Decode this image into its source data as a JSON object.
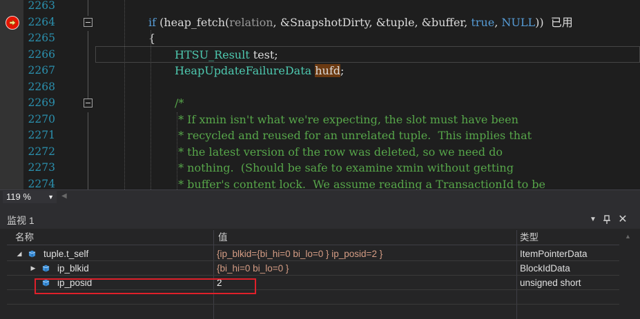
{
  "editor": {
    "line_numbers": [
      "2263",
      "2264",
      "2265",
      "2266",
      "2267",
      "2268",
      "2269",
      "2270",
      "2271",
      "2272",
      "2273",
      "2274"
    ],
    "lines": [
      {
        "segments": []
      },
      {
        "segments": [
          {
            "t": "if",
            "c": "kw"
          },
          {
            "t": " (heap_fetch(",
            "c": "fn"
          },
          {
            "t": "relation",
            "c": "param"
          },
          {
            "t": ", &SnapshotDirty, &tuple, &buffer, ",
            "c": "fn"
          },
          {
            "t": "true",
            "c": "kw"
          },
          {
            "t": ", ",
            "c": "fn"
          },
          {
            "t": "NULL",
            "c": "kw"
          },
          {
            "t": "))  已用",
            "c": "fn"
          }
        ]
      },
      {
        "segments": [
          {
            "t": "{",
            "c": "fn"
          }
        ]
      },
      {
        "segments": [
          {
            "t": "HTSU_Result",
            "c": "type"
          },
          {
            "t": " test;",
            "c": "fn"
          }
        ]
      },
      {
        "segments": [
          {
            "t": "HeapUpdateFailureData",
            "c": "type"
          },
          {
            "t": " ",
            "c": "fn"
          },
          {
            "t": "hufd",
            "c": "hl"
          },
          {
            "t": ";",
            "c": "fn"
          }
        ]
      },
      {
        "segments": []
      },
      {
        "segments": [
          {
            "t": "/*",
            "c": "cmt"
          }
        ]
      },
      {
        "segments": [
          {
            "t": " * If xmin isn't what we're expecting, the slot must have been",
            "c": "cmt"
          }
        ]
      },
      {
        "segments": [
          {
            "t": " * recycled and reused for an unrelated tuple.  This implies that",
            "c": "cmt"
          }
        ]
      },
      {
        "segments": [
          {
            "t": " * the latest version of the row was deleted, so we need do",
            "c": "cmt"
          }
        ]
      },
      {
        "segments": [
          {
            "t": " * nothing.  (Should be safe to examine xmin without getting",
            "c": "cmt"
          }
        ]
      },
      {
        "segments": [
          {
            "t": " * buffer's content lock.  We assume reading a TransactionId to be",
            "c": "cmt"
          }
        ]
      }
    ],
    "indent_levels": [
      0,
      2,
      2,
      3,
      3,
      3,
      3,
      3,
      3,
      3,
      3,
      3
    ],
    "breakpoint_line": "2264",
    "fold_lines": [
      "2264",
      "2269"
    ]
  },
  "status": {
    "zoom": "119 %"
  },
  "watch": {
    "title": "监视 1",
    "columns": {
      "name": "名称",
      "value": "值",
      "type": "类型"
    },
    "rows": [
      {
        "name": "tuple.t_self",
        "value": "{ip_blkid={bi_hi=0 bi_lo=0 } ip_posid=2 }",
        "type": "ItemPointerData",
        "level": 0,
        "expander": "expanded"
      },
      {
        "name": "ip_blkid",
        "value": "{bi_hi=0 bi_lo=0 }",
        "type": "BlockIdData",
        "level": 1,
        "expander": "collapsed"
      },
      {
        "name": "ip_posid",
        "value": "2",
        "type": "unsigned short",
        "level": 1,
        "expander": "none"
      },
      {
        "name": "",
        "value": "",
        "type": "",
        "level": 0,
        "expander": "none"
      }
    ]
  },
  "colors": {
    "breakpoint": "#e51400",
    "selection_box": "#e0202a",
    "comment": "#57a64a",
    "type": "#4ec9b0",
    "keyword": "#569cd6",
    "line_number": "#2b91af"
  },
  "icons": [
    "breakpoint-arrow-icon",
    "fold-minus-icon",
    "dropdown-icon",
    "pin-icon",
    "close-icon",
    "expand-arrow-icon",
    "collapse-arrow-icon",
    "watch-variable-cube-icon"
  ]
}
